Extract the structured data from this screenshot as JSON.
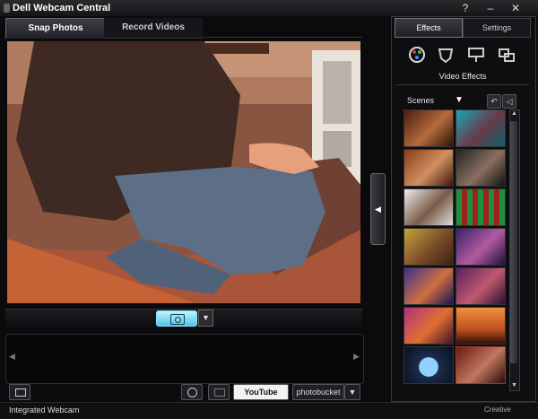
{
  "window": {
    "title": "Dell Webcam Central",
    "help": "?",
    "minimize": "–",
    "close": "✕"
  },
  "tabs": {
    "snap": "Snap Photos",
    "record": "Record Videos"
  },
  "right_tabs": {
    "effects": "Effects",
    "settings": "Settings"
  },
  "right_icons": [
    "palette-icon",
    "avatar-mask-icon",
    "presentation-icon",
    "overlay-icon"
  ],
  "video_effects": {
    "heading": "Video Effects",
    "category": "Scenes",
    "dropdown": "▼",
    "undo": "↶",
    "back": "◁"
  },
  "scroll": {
    "up": "▲",
    "down": "▼"
  },
  "collapse": {
    "arrow": "◀"
  },
  "controls": {
    "snap_dropdown": "▼"
  },
  "filmstrip": {
    "left": "◀",
    "right": "▶"
  },
  "bottom_buttons": {
    "youtube": "YouTube",
    "photobucket": "photobucket",
    "share_dropdown": "▼"
  },
  "status": {
    "device": "Integrated Webcam",
    "brand": "Creative"
  },
  "colors": {
    "accent": "#7fe3ff",
    "chrome": "#0b0b0d"
  }
}
